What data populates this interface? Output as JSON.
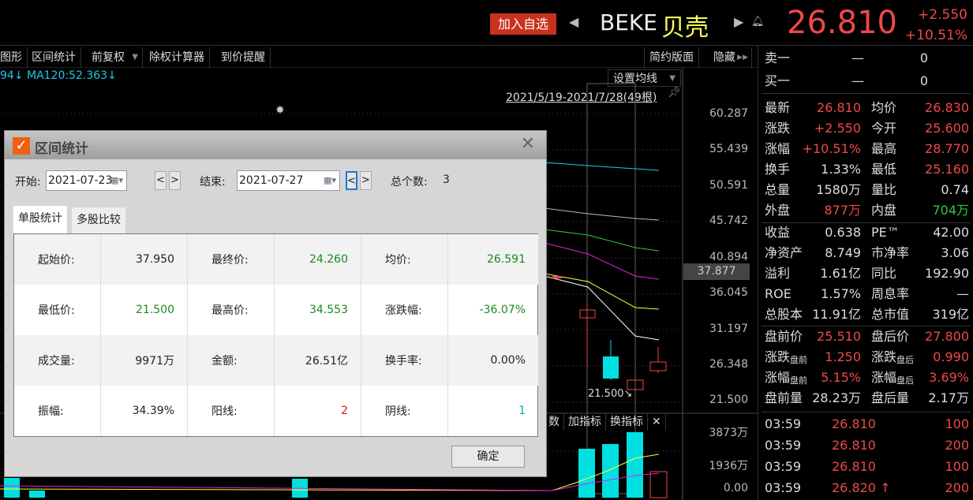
{
  "header": {
    "add_watch": "加入自选",
    "ticker": "BEKE",
    "name": "贝壳",
    "price": "26.810",
    "change": "+2.550",
    "change_pct": "+10.51%"
  },
  "toolbar": {
    "items": [
      "图形",
      "区间统计",
      "前复权",
      "除权计算器",
      "到价提醒"
    ],
    "right": [
      "简约版面",
      "隐藏"
    ]
  },
  "chart": {
    "ma_text": "94↓ MA120:52.363↓",
    "set_ma": "设置均线",
    "range": "2021/5/19-2021/7/28(49根)",
    "y_ticks": [
      "60.287",
      "55.439",
      "50.591",
      "45.742",
      "40.894",
      "36.045",
      "31.197",
      "26.348",
      "21.500"
    ],
    "current_price": "37.877",
    "low_label": "21.500↘",
    "vol_ticks": [
      "3873万",
      "1936万",
      "0.00"
    ],
    "indicator_buttons": [
      "数",
      "加指标",
      "换指标"
    ]
  },
  "dialog": {
    "title": "区间统计",
    "start_label": "开始:",
    "start": "2021-07-23",
    "end_label": "结束:",
    "end": "2021-07-27",
    "prev": "<",
    "next": ">",
    "count_label": "总个数:",
    "count": "3",
    "tabs": [
      "单股统计",
      "多股比较"
    ],
    "ok": "确定",
    "rows": [
      [
        {
          "l": "起始价:",
          "v": "37.950",
          "c": "#222"
        },
        {
          "l": "最终价:",
          "v": "24.260",
          "c": "#1a8a1a"
        },
        {
          "l": "均价:",
          "v": "26.591",
          "c": "#1a8a1a"
        }
      ],
      [
        {
          "l": "最低价:",
          "v": "21.500",
          "c": "#1a8a1a"
        },
        {
          "l": "最高价:",
          "v": "34.553",
          "c": "#1a8a1a"
        },
        {
          "l": "涨跌幅:",
          "v": "-36.07%",
          "c": "#1a8a1a"
        }
      ],
      [
        {
          "l": "成交量:",
          "v": "9971万",
          "c": "#222"
        },
        {
          "l": "金额:",
          "v": "26.51亿",
          "c": "#222"
        },
        {
          "l": "换手率:",
          "v": "0.00%",
          "c": "#222"
        }
      ],
      [
        {
          "l": "振幅:",
          "v": "34.39%",
          "c": "#222"
        },
        {
          "l": "阳线:",
          "v": "2",
          "c": "#e01010"
        },
        {
          "l": "阴线:",
          "v": "1",
          "c": "#0aa"
        }
      ]
    ]
  },
  "quote": {
    "book": [
      {
        "label": "卖一",
        "price": "—",
        "vol": "0"
      },
      {
        "label": "买一",
        "price": "—",
        "vol": "0"
      }
    ],
    "stats": [
      [
        {
          "l": "最新",
          "v": "26.810",
          "c": "red"
        },
        {
          "l": "均价",
          "v": "26.830",
          "c": "red"
        }
      ],
      [
        {
          "l": "涨跌",
          "v": "+2.550",
          "c": "red"
        },
        {
          "l": "今开",
          "v": "25.600",
          "c": "red"
        }
      ],
      [
        {
          "l": "涨幅",
          "v": "+10.51%",
          "c": "red"
        },
        {
          "l": "最高",
          "v": "28.770",
          "c": "red"
        }
      ],
      [
        {
          "l": "换手",
          "v": "1.33%",
          "c": "wht"
        },
        {
          "l": "最低",
          "v": "25.160",
          "c": "red"
        }
      ],
      [
        {
          "l": "总量",
          "v": "1580万",
          "c": "wht"
        },
        {
          "l": "量比",
          "v": "0.74",
          "c": "wht"
        }
      ],
      [
        {
          "l": "外盘",
          "v": "877万",
          "c": "red"
        },
        {
          "l": "内盘",
          "v": "704万",
          "c": "grn"
        }
      ]
    ],
    "fund": [
      [
        {
          "l": "收益",
          "v": "0.638",
          "c": "wht"
        },
        {
          "l": "PE™",
          "v": "42.00",
          "c": "wht"
        }
      ],
      [
        {
          "l": "净资产",
          "v": "8.749",
          "c": "wht"
        },
        {
          "l": "市净率",
          "v": "3.06",
          "c": "wht"
        }
      ],
      [
        {
          "l": "溢利",
          "v": "1.61亿",
          "c": "wht"
        },
        {
          "l": "同比",
          "v": "192.90",
          "c": "wht"
        }
      ],
      [
        {
          "l": "ROE",
          "v": "1.57%",
          "c": "wht"
        },
        {
          "l": "周息率",
          "v": "—",
          "c": "wht"
        }
      ],
      [
        {
          "l": "总股本",
          "v": "11.91亿",
          "c": "wht"
        },
        {
          "l": "总市值",
          "v": "319亿",
          "c": "wht"
        }
      ]
    ],
    "ext": [
      [
        {
          "l": "盘前价",
          "s": "",
          "v": "25.510",
          "c": "red"
        },
        {
          "l": "盘后价",
          "s": "",
          "v": "27.800",
          "c": "red"
        }
      ],
      [
        {
          "l": "涨跌",
          "s": "盘前",
          "v": "1.250",
          "c": "red"
        },
        {
          "l": "涨跌",
          "s": "盘后",
          "v": "0.990",
          "c": "red"
        }
      ],
      [
        {
          "l": "涨幅",
          "s": "盘前",
          "v": "5.15%",
          "c": "red"
        },
        {
          "l": "涨幅",
          "s": "盘后",
          "v": "3.69%",
          "c": "red"
        }
      ],
      [
        {
          "l": "盘前量",
          "s": "",
          "v": "28.23万",
          "c": "wht"
        },
        {
          "l": "盘后量",
          "s": "",
          "v": "2.17万",
          "c": "wht"
        }
      ]
    ],
    "trades": [
      {
        "t": "03:59",
        "p": "26.810",
        "v": "100"
      },
      {
        "t": "03:59",
        "p": "26.810",
        "v": "200"
      },
      {
        "t": "03:59",
        "p": "26.810",
        "v": "100"
      },
      {
        "t": "03:59",
        "p": "26.820 ↑",
        "v": "200"
      }
    ]
  }
}
